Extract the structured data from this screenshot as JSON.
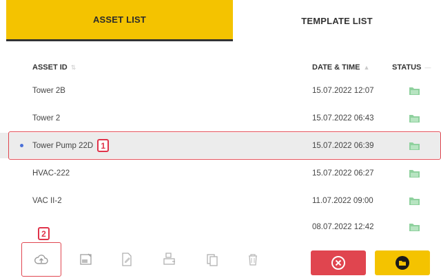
{
  "tabs": {
    "asset_list": "ASSET LIST",
    "template_list": "TEMPLATE LIST"
  },
  "columns": {
    "asset_id": "ASSET ID",
    "date_time": "DATE & TIME",
    "status": "STATUS"
  },
  "rows": [
    {
      "asset_id": "Tower 2B",
      "date_time": "15.07.2022 12:07"
    },
    {
      "asset_id": "Tower 2",
      "date_time": "15.07.2022 06:43"
    },
    {
      "asset_id": "Tower Pump 22D",
      "date_time": "15.07.2022 06:39",
      "selected": true
    },
    {
      "asset_id": "HVAC-222",
      "date_time": "15.07.2022 06:27"
    },
    {
      "asset_id": "VAC II-2",
      "date_time": "11.07.2022 09:00"
    },
    {
      "asset_id": "",
      "date_time": "08.07.2022 12:42"
    }
  ],
  "callouts": {
    "one": "1",
    "two": "2"
  },
  "colors": {
    "accent_yellow": "#f4c300",
    "cancel_red": "#e0454f",
    "status_green": "#8fd19e"
  },
  "toolbar_icons": [
    "cloud-upload-icon",
    "export-report-icon",
    "edit-document-icon",
    "print-icon",
    "copy-icon",
    "delete-icon"
  ]
}
